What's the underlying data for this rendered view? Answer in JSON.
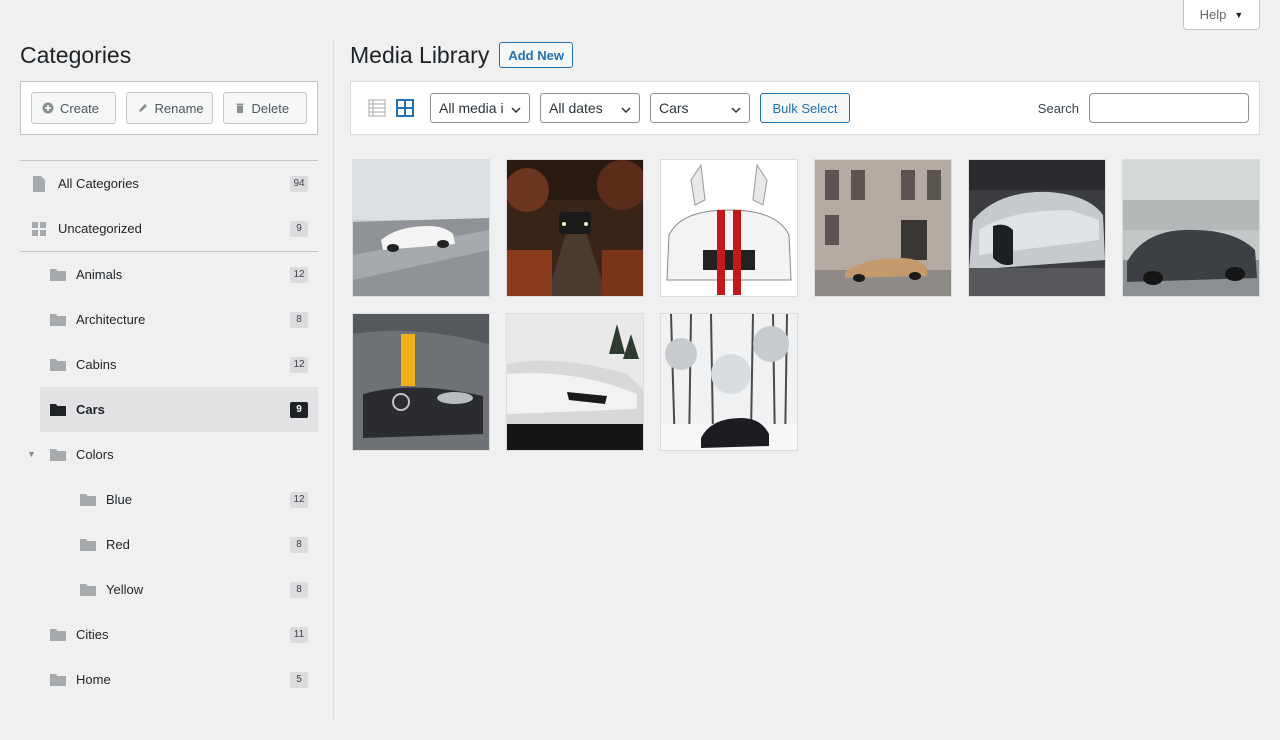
{
  "help": {
    "label": "Help"
  },
  "sidebar": {
    "title": "Categories",
    "toolbar": {
      "create": "Create",
      "rename": "Rename",
      "delete": "Delete"
    },
    "top_items": [
      {
        "label": "All Categories",
        "count": "94",
        "icon": "document-icon"
      },
      {
        "label": "Uncategorized",
        "count": "9",
        "icon": "grid-icon"
      }
    ],
    "folders": [
      {
        "label": "Animals",
        "count": "12"
      },
      {
        "label": "Architecture",
        "count": "8"
      },
      {
        "label": "Cabins",
        "count": "12"
      },
      {
        "label": "Cars",
        "count": "9",
        "active": true
      },
      {
        "label": "Colors",
        "count": "",
        "expanded": true
      },
      {
        "label": "Blue",
        "count": "12"
      },
      {
        "label": "Red",
        "count": "8"
      },
      {
        "label": "Yellow",
        "count": "8"
      },
      {
        "label": "Cities",
        "count": "11"
      },
      {
        "label": "Home",
        "count": "5"
      }
    ]
  },
  "main": {
    "title": "Media Library",
    "add_new": "Add New",
    "filters": {
      "media_type": "All media i",
      "dates": "All dates",
      "category": "Cars"
    },
    "bulk_select": "Bulk Select",
    "search_label": "Search",
    "search_value": "",
    "thumbnails": [
      "white-sports-car-on-road",
      "car-in-autumn-forest",
      "white-mustang-red-stripes",
      "gold-supercar-by-building",
      "silver-bugatti",
      "dark-coupe-in-fog",
      "grey-mercedes-yellow-stripe",
      "white-lamborghini-front",
      "black-car-in-snow-forest"
    ]
  },
  "colors": {
    "accent": "#2271b1",
    "active_badge": "#1d2327"
  }
}
